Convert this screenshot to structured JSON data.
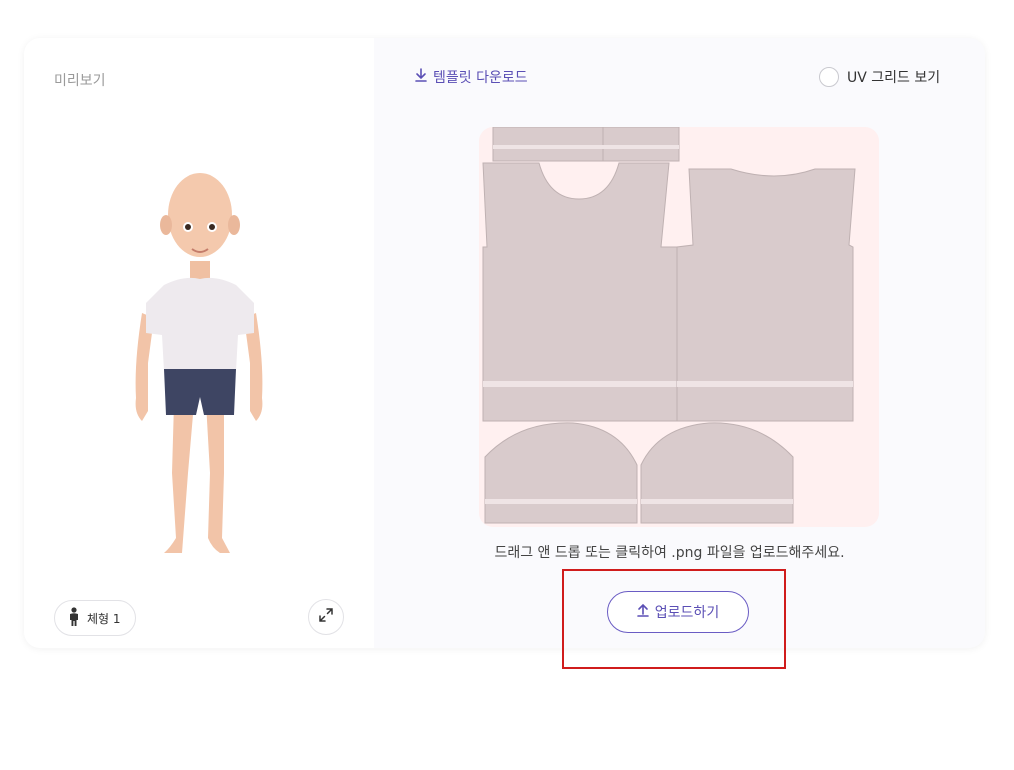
{
  "preview": {
    "title": "미리보기",
    "body_type_label": "체형 1",
    "body_type_icon": "person-icon",
    "expand_icon": "expand-icon"
  },
  "editor": {
    "download_label": "템플릿 다운로드",
    "download_icon": "download-icon",
    "uv_grid_label": "UV 그리드 보기",
    "uv_grid_checked": false,
    "hint": "드래그 앤 드롭 또는 클릭하여 .png 파일을 업로드해주세요.",
    "upload_label": "업로드하기",
    "upload_icon": "upload-icon"
  },
  "colors": {
    "accent": "#5b4fb5",
    "highlight": "#d01c1c",
    "template_bg": "#fff0f0"
  }
}
